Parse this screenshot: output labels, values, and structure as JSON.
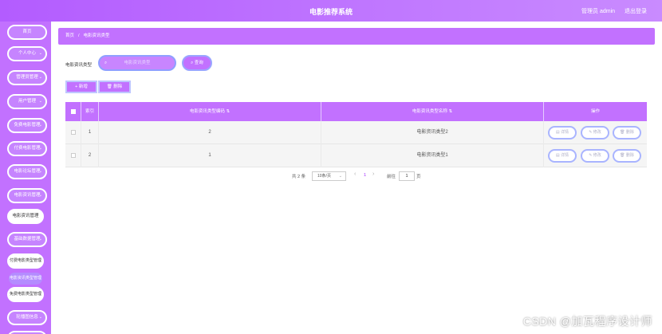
{
  "header": {
    "title": "电影推荐系统",
    "user": "管理员 admin",
    "logout": "退出登录"
  },
  "sidebar": {
    "items": [
      {
        "label": "首页",
        "has_chevron": false
      },
      {
        "label": "个人中心",
        "has_chevron": true
      },
      {
        "label": "管理员管理",
        "has_chevron": true
      },
      {
        "label": "用户管理",
        "has_chevron": true
      },
      {
        "label": "免费电影管理",
        "has_chevron": true
      },
      {
        "label": "付费电影管理",
        "has_chevron": true
      },
      {
        "label": "电影论坛管理",
        "has_chevron": true
      },
      {
        "label": "电影资讯管理",
        "has_chevron": true
      },
      {
        "label": "电影资讯管理"
      },
      {
        "label": "基础数据管理",
        "has_chevron": true
      },
      {
        "label": "付费电影类型管理"
      },
      {
        "label": "电影资讯类型管理"
      },
      {
        "label": "免费电影类型管理"
      },
      {
        "label": "轮播图信息",
        "has_chevron": true
      }
    ]
  },
  "breadcrumb": {
    "home": "首页",
    "separator": "/",
    "current": "电影资讯类型"
  },
  "search": {
    "label": "电影资讯类型",
    "placeholder": "电影资讯类型",
    "button": "查询"
  },
  "toolbar": {
    "add": "新增",
    "delete": "删除"
  },
  "table": {
    "headers": {
      "index": "索引",
      "code": "电影资讯类型编码",
      "name": "电影资讯类型名称",
      "actions": "操作"
    },
    "sort_icon": "⇅",
    "rows": [
      {
        "index": "1",
        "code": "2",
        "name": "电影资讯类型2"
      },
      {
        "index": "2",
        "code": "1",
        "name": "电影资讯类型1"
      }
    ],
    "row_actions": {
      "detail": "详情",
      "edit": "修改",
      "delete": "删除"
    }
  },
  "pagination": {
    "total": "共 2 条",
    "page_size": "10条/页",
    "prev": "‹",
    "current_page": "1",
    "next": "›",
    "goto_label": "前往",
    "goto_value": "1",
    "page_suffix": "页"
  },
  "watermark": "CSDN @加瓦程序设计师",
  "colors": {
    "primary": "#c271ff",
    "header_gradient_start": "#b35cff",
    "header_gradient_end": "#c98bff",
    "button_border": "#a9b4ff"
  }
}
